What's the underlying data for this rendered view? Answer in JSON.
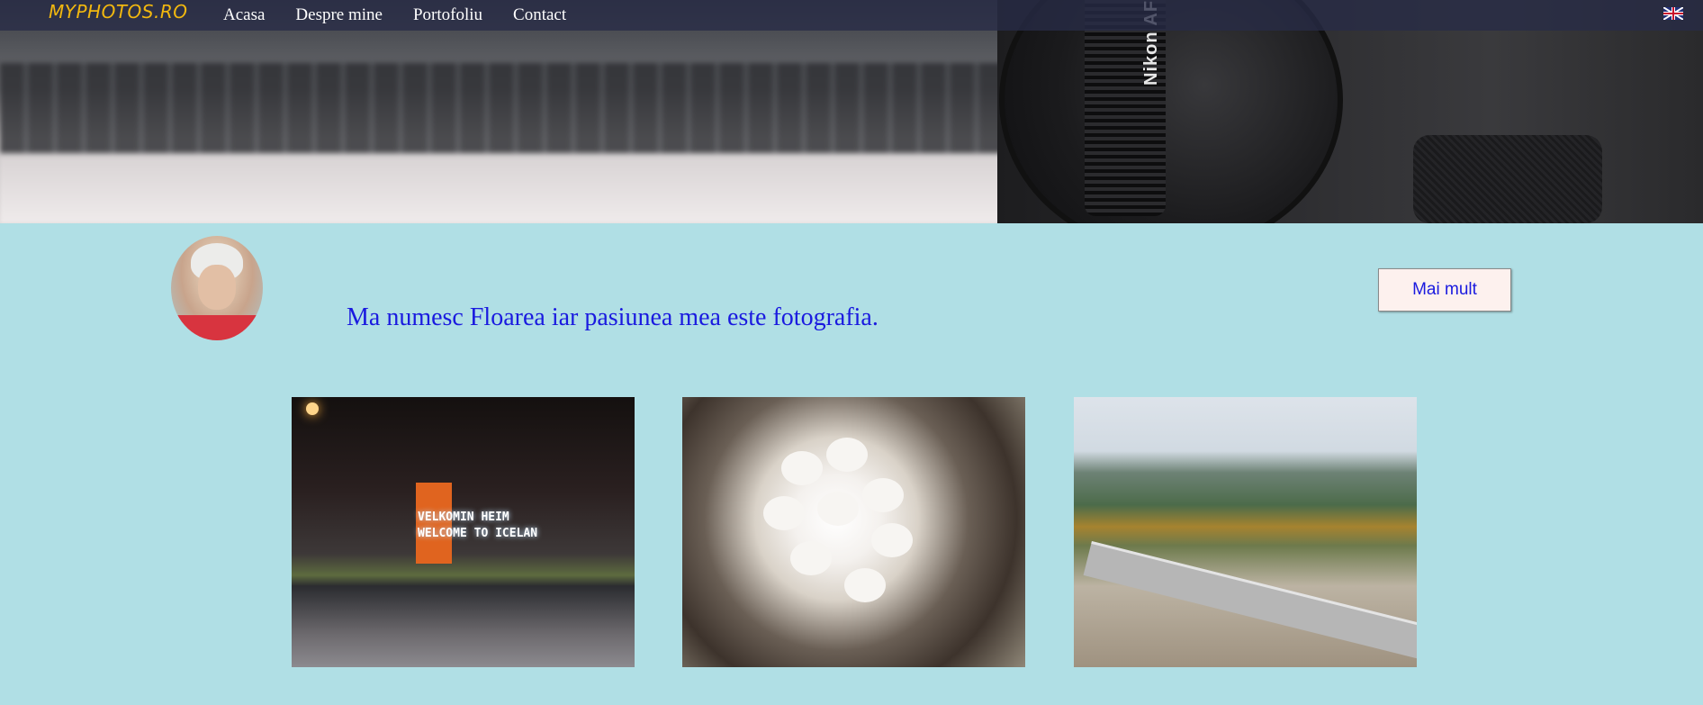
{
  "site": {
    "logo": "MYPHOTOS.RO"
  },
  "nav": {
    "items": [
      "Acasa",
      "Despre mine",
      "Portofoliu",
      "Contact"
    ]
  },
  "language": {
    "flag": "uk-flag-icon"
  },
  "hero": {
    "lens_text": "Nikon AF NIKKOR"
  },
  "intro": {
    "text": "Ma numesc Floarea iar pasiunea mea este fotografia.",
    "button_label": "Mai mult"
  },
  "gallery": {
    "photos": [
      {
        "sign_line1": "VELKOMIN HEIM",
        "sign_line2": "WELCOME TO ICELAN"
      },
      {
        "subject": "flower"
      },
      {
        "subject": "road"
      }
    ]
  },
  "colors": {
    "background": "#b0dfe5",
    "logo": "#f2b80f",
    "intro_text": "#1a1adf",
    "button_bg": "#fdf1ee"
  }
}
